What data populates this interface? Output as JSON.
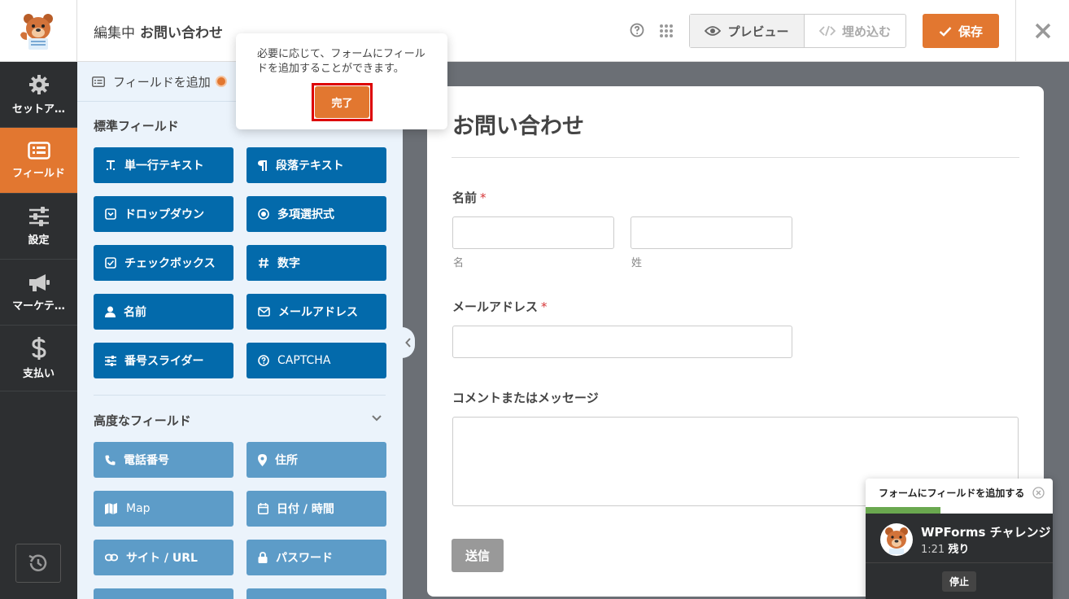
{
  "topbar": {
    "editing_label": "編集中",
    "form_name": "お問い合わせ",
    "preview_label": "プレビュー",
    "embed_label": "埋め込む",
    "save_label": "保存"
  },
  "nav": {
    "items": [
      {
        "label": "セットア…",
        "icon": "gear-icon"
      },
      {
        "label": "フィールド",
        "icon": "fields-icon"
      },
      {
        "label": "設定",
        "icon": "sliders-icon"
      },
      {
        "label": "マーケテ…",
        "icon": "megaphone-icon"
      },
      {
        "label": "支払い",
        "icon": "dollar-icon"
      }
    ]
  },
  "panel": {
    "tab_label": "フィールドを追加",
    "standard_title": "標準フィールド",
    "standard_fields": [
      {
        "label": "単一行テキスト",
        "icon": "text-icon"
      },
      {
        "label": "段落テキスト",
        "icon": "paragraph-icon"
      },
      {
        "label": "ドロップダウン",
        "icon": "dropdown-icon"
      },
      {
        "label": "多項選択式",
        "icon": "radio-icon"
      },
      {
        "label": "チェックボックス",
        "icon": "checkbox-icon"
      },
      {
        "label": "数字",
        "icon": "hash-icon"
      },
      {
        "label": "名前",
        "icon": "user-icon"
      },
      {
        "label": "メールアドレス",
        "icon": "envelope-icon"
      },
      {
        "label": "番号スライダー",
        "icon": "sliders-icon"
      },
      {
        "label": "CAPTCHA",
        "icon": "question-icon"
      }
    ],
    "advanced_title": "高度なフィールド",
    "advanced_fields": [
      {
        "label": "電話番号",
        "icon": "phone-icon"
      },
      {
        "label": "住所",
        "icon": "map-marker-icon"
      },
      {
        "label": "Map",
        "icon": "map-icon"
      },
      {
        "label": "日付 / 時間",
        "icon": "calendar-icon"
      },
      {
        "label": "サイト / URL",
        "icon": "link-icon"
      },
      {
        "label": "パスワード",
        "icon": "lock-icon"
      }
    ]
  },
  "form": {
    "title": "お問い合わせ",
    "name_label": "名前",
    "required_mark": "*",
    "first_sublabel": "名",
    "last_sublabel": "姓",
    "email_label": "メールアドレス",
    "comment_label": "コメントまたはメッセージ",
    "submit_label": "送信"
  },
  "tooltip": {
    "text": "必要に応じて、フォームにフィールドを追加することができます。",
    "done_label": "完了"
  },
  "challenge": {
    "header": "フォームにフィールドを追加する",
    "title": "WPForms チャレンジ",
    "time": "1:21",
    "time_suffix": "残り",
    "stop_label": "停止",
    "progress": 0.4
  },
  "colors": {
    "accent": "#e27730",
    "field_button": "#036aab",
    "field_button_advanced": "#5d9cc8",
    "nav_bg": "#2d2f31",
    "panel_bg": "#ebf3fb"
  }
}
